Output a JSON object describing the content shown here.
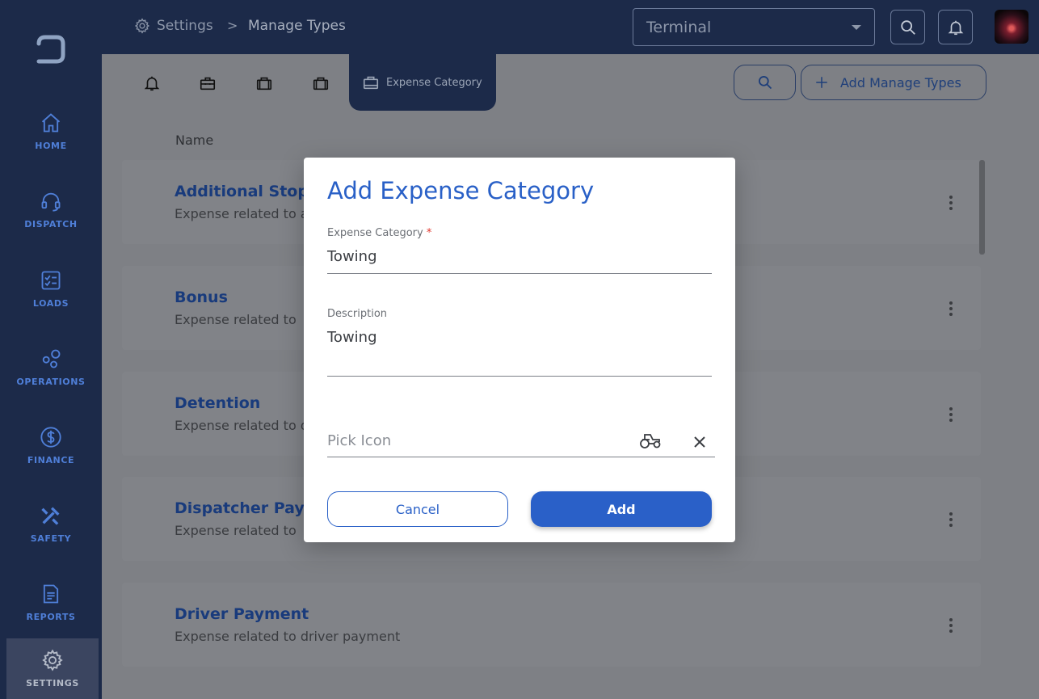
{
  "sidebar": {
    "items": [
      {
        "label": "HOME",
        "icon": "home-icon"
      },
      {
        "label": "DISPATCH",
        "icon": "headset-icon"
      },
      {
        "label": "LOADS",
        "icon": "checklist-icon"
      },
      {
        "label": "OPERATIONS",
        "icon": "operations-icon"
      },
      {
        "label": "FINANCE",
        "icon": "dollar-icon"
      },
      {
        "label": "SAFETY",
        "icon": "tools-icon"
      },
      {
        "label": "REPORTS",
        "icon": "report-icon"
      },
      {
        "label": "SETTINGS",
        "icon": "gear-icon",
        "active": true
      }
    ]
  },
  "header": {
    "breadcrumb_root": "Settings",
    "breadcrumb_sep": ">",
    "breadcrumb_current": "Manage Types",
    "terminal_value": "Terminal"
  },
  "tabs": {
    "active_label": "Expense Category",
    "icons": [
      "bell-icon",
      "toolbox-icon",
      "briefcase-icon",
      "briefcase-icon",
      "briefcase-icon"
    ]
  },
  "toolbar": {
    "add_label": "Add Manage Types"
  },
  "list": {
    "column_header": "Name",
    "rows": [
      {
        "title": "Additional Stop",
        "desc": "Expense related to a"
      },
      {
        "title": "Bonus",
        "desc": "Expense related to"
      },
      {
        "title": "Detention",
        "desc": "Expense related to d"
      },
      {
        "title": "Dispatcher Paym",
        "desc": "Expense related to"
      },
      {
        "title": "Driver Payment",
        "desc": "Expense related to driver payment"
      }
    ]
  },
  "dialog": {
    "title": "Add Expense Category",
    "category_label": "Expense Category",
    "required_mark": "*",
    "category_value": "Towing",
    "description_label": "Description",
    "description_value": "Towing",
    "pick_icon_placeholder": "Pick Icon",
    "selected_icon": "tractor-icon",
    "cancel_label": "Cancel",
    "add_label": "Add"
  },
  "colors": {
    "sidebar_bg": "#1c2a49",
    "accent": "#2960c7",
    "nav_text": "#4f7fd8",
    "required": "#e0352b"
  }
}
